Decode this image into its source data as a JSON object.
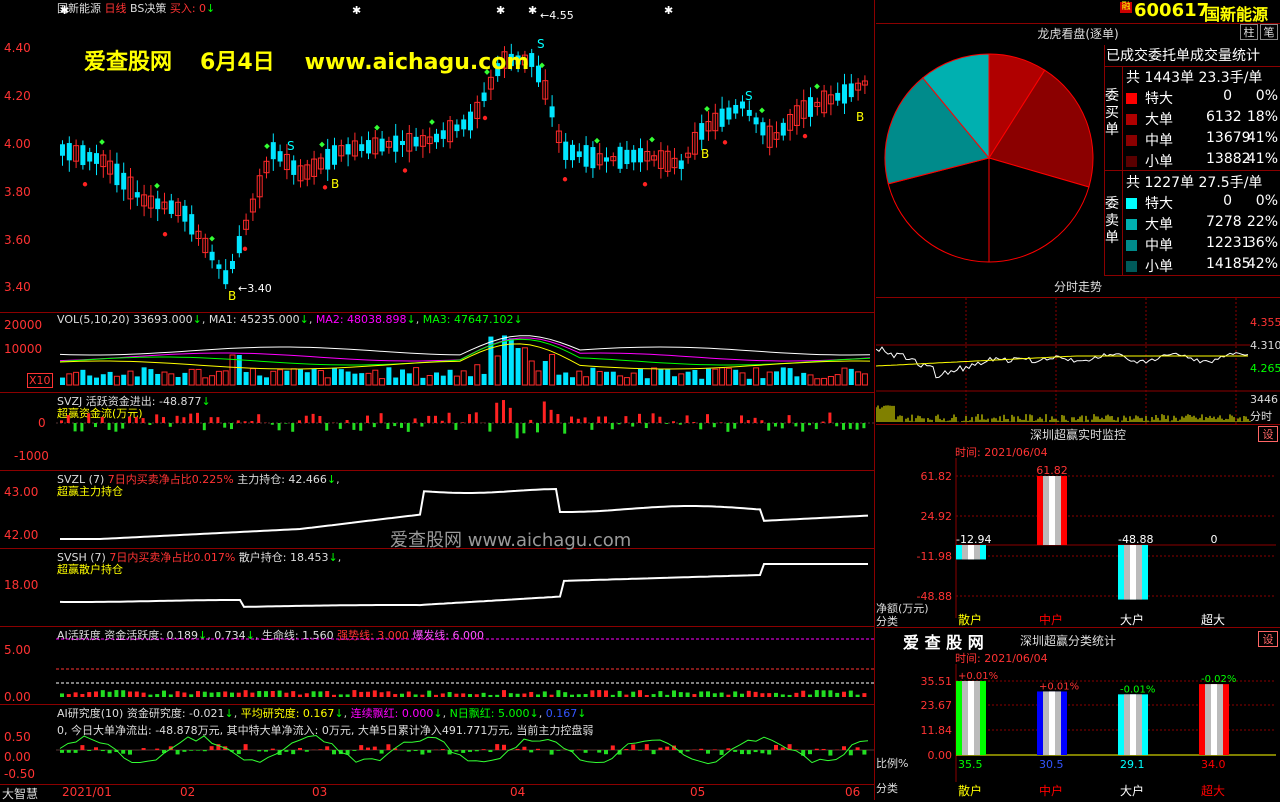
{
  "stock": {
    "code": "600617",
    "name": "国新能源",
    "badge": "融",
    "btn_pillar": "柱",
    "btn_note": "笔"
  },
  "kline": {
    "header_name": "国新能源",
    "header_period": "日线",
    "header_strategy": "BS决策",
    "header_buy": "买入: 0",
    "y_labels": [
      "4.40",
      "4.20",
      "4.00",
      "3.80",
      "3.60",
      "3.40"
    ],
    "high_label": "4.55",
    "low_label": "3.40",
    "watermark_site": "爱查股网",
    "watermark_date": "6月4日",
    "watermark_url": "www.aichagu.com"
  },
  "vol": {
    "header": "VOL(5,10,20)  33693.000",
    "ma1": "MA1: 45235.000",
    "ma2": "MA2: 48038.898",
    "ma3": "MA3: 47647.102",
    "y_labels": [
      "20000",
      "10000"
    ],
    "unit": "X10"
  },
  "svzj": {
    "header": "SVZJ  活跃资金进出: -48.877",
    "sub": "超赢资金流(万元)",
    "y_labels": [
      "0",
      "-1000"
    ]
  },
  "svzl": {
    "header_a": "SVZL (7)",
    "header_b": "7日内买卖净占比0.225%",
    "header_c": "主力持仓: 42.466",
    "sub": "超赢主力持仓",
    "y_labels": [
      "43.00",
      "42.00"
    ],
    "watermark": "爱查股网   www.aichagu.com"
  },
  "svsh": {
    "header_a": "SVSH (7)",
    "header_b": "7日内买卖净占比0.017%",
    "header_c": "散户持仓: 18.453",
    "sub": "超赢散户持仓",
    "y_labels": [
      "18.00"
    ]
  },
  "ai_active": {
    "header_a": "AI活跃度  资金活跃度: 0.189",
    "header_b": "0.734",
    "header_c": "生命线: 1.560",
    "header_d": "强势线: 3.000",
    "header_e": "爆发线: 6.000",
    "y_labels": [
      "5.00",
      "0.00"
    ]
  },
  "ai_research": {
    "header_a": "AI研究度(10)  资金研究度: -0.021",
    "header_b": "平均研究度: 0.167",
    "header_c": "连续飘红: 0.000",
    "header_d": "N日飘红: 5.000",
    "header_e": "0.167",
    "line2": "0, 今日大单净流出: -48.878万元, 其中特大单净流入: 0万元, 大单5日累计净入491.771万元, 当前主力控盘弱",
    "y_labels": [
      "0.50",
      "0.00",
      "-0.50"
    ]
  },
  "date_axis": {
    "app_name": "大智慧",
    "labels": [
      "2021/01",
      "02",
      "03",
      "04",
      "05",
      "06"
    ]
  },
  "dragon": {
    "title": "龙虎看盘(逐单)",
    "stats_title": "已成交委托单成交量统计",
    "buy_label": "委买单",
    "sell_label": "委卖单",
    "buy_total": "共 1443单 23.3手/单",
    "sell_total": "共 1227单 27.5手/单",
    "buy_rows": [
      {
        "name": "特大",
        "count": "0",
        "pct": "0%",
        "color": "#ff0000"
      },
      {
        "name": "大单",
        "count": "6132",
        "pct": "18%",
        "color": "#b00000"
      },
      {
        "name": "中单",
        "count": "13679",
        "pct": "41%",
        "color": "#8b0000"
      },
      {
        "name": "小单",
        "count": "13882",
        "pct": "41%",
        "color": "#5a0000"
      }
    ],
    "sell_rows": [
      {
        "name": "特大",
        "count": "0",
        "pct": "0%",
        "color": "#00ffff"
      },
      {
        "name": "大单",
        "count": "7278",
        "pct": "22%",
        "color": "#00b0b0"
      },
      {
        "name": "中单",
        "count": "12231",
        "pct": "36%",
        "color": "#008b8b"
      },
      {
        "name": "小单",
        "count": "14185",
        "pct": "42%",
        "color": "#005a5a"
      }
    ]
  },
  "timeshare": {
    "title": "分时走势",
    "prices": [
      "4.355",
      "4.310",
      "4.265"
    ],
    "vol_label": "3446",
    "vol_unit": "分时"
  },
  "monitor": {
    "title": "深圳超赢实时监控",
    "settings": "设",
    "time": "时间: 2021/06/04",
    "y_labels": [
      "61.82",
      "24.92",
      "-11.98",
      "-48.88"
    ],
    "bars": [
      {
        "label": "散户",
        "value": "-12.94",
        "amount": -12.94,
        "color": "#00ffff",
        "label_color": "#ffff00"
      },
      {
        "label": "中户",
        "value": "61.82",
        "amount": 61.82,
        "color": "#ff0000",
        "label_color": "#ff0000"
      },
      {
        "label": "大户",
        "value": "-48.88",
        "amount": -48.88,
        "color": "#00ffff",
        "label_color": "#ffffff"
      },
      {
        "label": "超大",
        "value": "0",
        "amount": 0,
        "color": "#ffffff",
        "label_color": "#ffffff"
      }
    ],
    "left_label_a": "净额(万元)",
    "left_label_b": "分类"
  },
  "classify": {
    "brand": "爱 查 股 网",
    "title": "深圳超赢分类统计",
    "settings": "设",
    "time": "时间: 2021/06/04",
    "y_labels": [
      "35.51",
      "23.67",
      "11.84",
      "0.00"
    ],
    "bars": [
      {
        "label": "散户",
        "ratio": "35.5",
        "ratio_value": 35.5,
        "delta": "+0.01%",
        "color": "#00ff00",
        "label_color": "#ffff00"
      },
      {
        "label": "中户",
        "ratio": "30.5",
        "ratio_value": 30.5,
        "delta": "+0.01%",
        "color": "#0000ff",
        "label_color": "#ff0000"
      },
      {
        "label": "大户",
        "ratio": "29.1",
        "ratio_value": 29.1,
        "delta": "-0.01%",
        "color": "#00ffff",
        "label_color": "#ffffff"
      },
      {
        "label": "超大",
        "ratio": "34.0",
        "ratio_value": 34.0,
        "delta": "-0.02%",
        "color": "#ff0000",
        "label_color": "#ff0000"
      }
    ],
    "left_label_a": "比例%",
    "left_label_b": "分类"
  }
}
